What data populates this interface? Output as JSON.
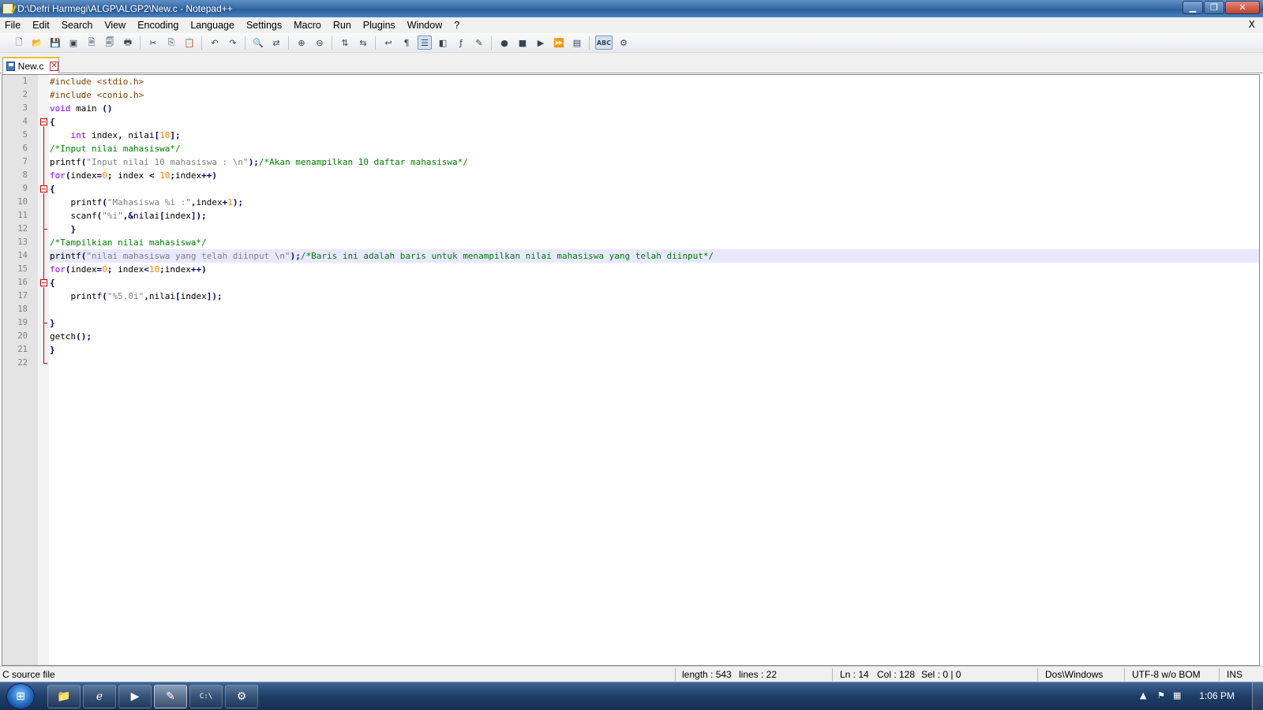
{
  "window": {
    "title": "D:\\Defri Harmegi\\ALGP\\ALGP2\\New.c - Notepad++",
    "minimize_glyph": "▁",
    "maximize_glyph": "❐",
    "close_glyph": "✕"
  },
  "menu": {
    "items": [
      "File",
      "Edit",
      "Search",
      "View",
      "Encoding",
      "Language",
      "Settings",
      "Macro",
      "Run",
      "Plugins",
      "Window",
      "?"
    ],
    "doc_close": "X"
  },
  "toolbar": {
    "buttons": [
      {
        "name": "new-file-icon",
        "glyph": "🗋"
      },
      {
        "name": "open-file-icon",
        "glyph": "📂"
      },
      {
        "name": "save-icon",
        "glyph": "💾"
      },
      {
        "name": "save-all-icon",
        "glyph": "▣"
      },
      {
        "name": "close-file-icon",
        "glyph": "🗎"
      },
      {
        "name": "close-all-icon",
        "glyph": "🗐"
      },
      {
        "name": "print-icon",
        "glyph": "🖶"
      },
      {
        "sep": true
      },
      {
        "name": "cut-icon",
        "glyph": "✂"
      },
      {
        "name": "copy-icon",
        "glyph": "⎘"
      },
      {
        "name": "paste-icon",
        "glyph": "📋"
      },
      {
        "sep": true
      },
      {
        "name": "undo-icon",
        "glyph": "↶"
      },
      {
        "name": "redo-icon",
        "glyph": "↷"
      },
      {
        "sep": true
      },
      {
        "name": "find-icon",
        "glyph": "🔍"
      },
      {
        "name": "replace-icon",
        "glyph": "⇄"
      },
      {
        "sep": true
      },
      {
        "name": "zoom-in-icon",
        "glyph": "⊕"
      },
      {
        "name": "zoom-out-icon",
        "glyph": "⊖"
      },
      {
        "sep": true
      },
      {
        "name": "sync-vertical-icon",
        "glyph": "⇅"
      },
      {
        "name": "sync-horizontal-icon",
        "glyph": "⇆"
      },
      {
        "sep": true
      },
      {
        "name": "word-wrap-icon",
        "glyph": "↩"
      },
      {
        "name": "show-all-chars-icon",
        "glyph": "¶"
      },
      {
        "name": "indent-guide-icon",
        "glyph": "☰",
        "active": true
      },
      {
        "name": "document-map-icon",
        "glyph": "◧"
      },
      {
        "name": "function-list-icon",
        "glyph": "ƒ"
      },
      {
        "name": "folder-workspace-icon",
        "glyph": "✎"
      },
      {
        "sep": true
      },
      {
        "name": "macro-record-icon",
        "glyph": "●"
      },
      {
        "name": "macro-stop-icon",
        "glyph": "■"
      },
      {
        "name": "macro-play-icon",
        "glyph": "▶"
      },
      {
        "name": "macro-play-multiple-icon",
        "glyph": "⏩"
      },
      {
        "name": "macro-save-icon",
        "glyph": "▤"
      },
      {
        "sep": true
      },
      {
        "name": "spell-check-icon",
        "glyph": "ABC",
        "active": true
      },
      {
        "name": "plugin-icon",
        "glyph": "⚙"
      }
    ]
  },
  "tab": {
    "label": "New.c",
    "close": "✕"
  },
  "editor": {
    "current_line": 14,
    "lines": [
      {
        "n": "1",
        "tokens": [
          [
            "pp",
            "#include <stdio.h>"
          ]
        ]
      },
      {
        "n": "2",
        "tokens": [
          [
            "pp",
            "#include <conio.h>"
          ]
        ]
      },
      {
        "n": "3",
        "tokens": [
          [
            "kw",
            "void"
          ],
          [
            "",
            " main "
          ],
          [
            "op",
            "()"
          ]
        ]
      },
      {
        "n": "4",
        "tokens": [
          [
            "op",
            "{"
          ]
        ]
      },
      {
        "n": "5",
        "tokens": [
          [
            "",
            "    "
          ],
          [
            "kw",
            "int"
          ],
          [
            "",
            " index"
          ],
          [
            "op",
            ","
          ],
          [
            "",
            " nilai"
          ],
          [
            "op",
            "["
          ],
          [
            "num",
            "10"
          ],
          [
            "op",
            "];"
          ]
        ]
      },
      {
        "n": "6",
        "tokens": [
          [
            "cm",
            "/*Input nilai mahasiswa*/"
          ]
        ]
      },
      {
        "n": "7",
        "tokens": [
          [
            "",
            "printf"
          ],
          [
            "op",
            "("
          ],
          [
            "str",
            "\"Input nilai 10 mahasiswa : \\n\""
          ],
          [
            "op",
            ");"
          ],
          [
            "cm",
            "/*Akan menampilkan 10 daftar mahasiswa*/"
          ]
        ]
      },
      {
        "n": "8",
        "tokens": [
          [
            "kw",
            "for"
          ],
          [
            "op",
            "("
          ],
          [
            "",
            "index"
          ],
          [
            "op",
            "="
          ],
          [
            "num",
            "0"
          ],
          [
            "op",
            ";"
          ],
          [
            "",
            " index "
          ],
          [
            "op",
            "<"
          ],
          [
            "",
            " "
          ],
          [
            "num",
            "10"
          ],
          [
            "op",
            ";"
          ],
          [
            "",
            "index"
          ],
          [
            "op",
            "++)"
          ]
        ]
      },
      {
        "n": "9",
        "tokens": [
          [
            "op",
            "{"
          ]
        ]
      },
      {
        "n": "10",
        "tokens": [
          [
            "",
            "    printf"
          ],
          [
            "op",
            "("
          ],
          [
            "str",
            "\"Mahasiswa %i :\""
          ],
          [
            "op",
            ","
          ],
          [
            "",
            "index"
          ],
          [
            "op",
            "+"
          ],
          [
            "num",
            "1"
          ],
          [
            "op",
            ");"
          ]
        ]
      },
      {
        "n": "11",
        "tokens": [
          [
            "",
            "    scanf"
          ],
          [
            "op",
            "("
          ],
          [
            "str",
            "\"%i\""
          ],
          [
            "op",
            ",&"
          ],
          [
            "",
            "nilai"
          ],
          [
            "op",
            "["
          ],
          [
            "",
            "index"
          ],
          [
            "op",
            "]);"
          ]
        ]
      },
      {
        "n": "12",
        "tokens": [
          [
            "",
            "    "
          ],
          [
            "op",
            "}"
          ]
        ]
      },
      {
        "n": "13",
        "tokens": [
          [
            "cm",
            "/*Tampilkian nilai mahasiswa*/"
          ]
        ]
      },
      {
        "n": "14",
        "tokens": [
          [
            "",
            "printf"
          ],
          [
            "op",
            "("
          ],
          [
            "str",
            "\"nilai mahasiswa yang telah diinput \\n\""
          ],
          [
            "op",
            ");"
          ],
          [
            "cm",
            "/*Baris ini adalah baris untuk menampilkan nilai mahasiswa yang telah diinput*/"
          ]
        ]
      },
      {
        "n": "15",
        "tokens": [
          [
            "kw",
            "for"
          ],
          [
            "op",
            "("
          ],
          [
            "",
            "index"
          ],
          [
            "op",
            "="
          ],
          [
            "num",
            "0"
          ],
          [
            "op",
            ";"
          ],
          [
            "",
            " index"
          ],
          [
            "op",
            "<"
          ],
          [
            "num",
            "10"
          ],
          [
            "op",
            ";"
          ],
          [
            "",
            "index"
          ],
          [
            "op",
            "++)"
          ]
        ]
      },
      {
        "n": "16",
        "tokens": [
          [
            "op",
            "{"
          ]
        ]
      },
      {
        "n": "17",
        "tokens": [
          [
            "",
            "    printf"
          ],
          [
            "op",
            "("
          ],
          [
            "str",
            "\"%5.0i\""
          ],
          [
            "op",
            ","
          ],
          [
            "",
            "nilai"
          ],
          [
            "op",
            "["
          ],
          [
            "",
            "index"
          ],
          [
            "op",
            "]);"
          ]
        ]
      },
      {
        "n": "18",
        "tokens": []
      },
      {
        "n": "19",
        "tokens": [
          [
            "op",
            "}"
          ]
        ]
      },
      {
        "n": "20",
        "tokens": [
          [
            "",
            "getch"
          ],
          [
            "op",
            "();"
          ]
        ]
      },
      {
        "n": "21",
        "tokens": [
          [
            "op",
            "}"
          ]
        ]
      },
      {
        "n": "22",
        "tokens": []
      }
    ]
  },
  "status": {
    "file_type": "C source file",
    "length": "length : 543",
    "lines": "lines : 22",
    "ln": "Ln : 14",
    "col": "Col : 128",
    "sel": "Sel : 0 | 0",
    "eol": "Dos\\Windows",
    "encoding": "UTF-8 w/o BOM",
    "mode": "INS"
  },
  "taskbar": {
    "start_glyph": "⊞",
    "apps": [
      {
        "name": "explorer-taskbar-icon",
        "glyph": "📁"
      },
      {
        "name": "ie-taskbar-icon",
        "glyph": "ℯ"
      },
      {
        "name": "media-player-taskbar-icon",
        "glyph": "▶"
      },
      {
        "name": "notepadpp-taskbar-icon",
        "glyph": "✎",
        "active": true
      },
      {
        "name": "cmd-taskbar-icon",
        "glyph": "C:\\"
      },
      {
        "name": "compiler-taskbar-icon",
        "glyph": "⚙"
      }
    ],
    "tray_arrow": "▲",
    "tray_flag": "⚑",
    "tray_network": "▦",
    "clock": "1:06 PM"
  },
  "colors": {
    "preprocessor": "#804000",
    "keyword": "#8000ff",
    "number": "#ff8000",
    "string": "#808080",
    "comment": "#008000",
    "operator": "#000080",
    "current_line_bg": "#e8e8ff",
    "fold_marker": "#d00000"
  }
}
